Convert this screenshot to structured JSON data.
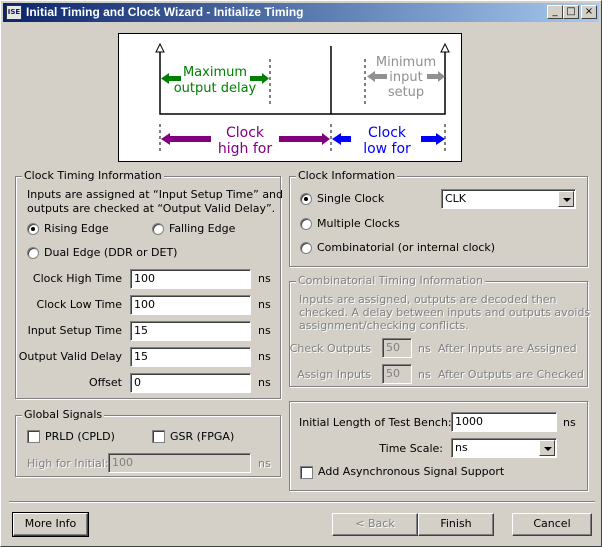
{
  "window": {
    "title": "Initial Timing and Clock Wizard - Initialize Timing",
    "app_icon_text": "ISE",
    "minimize_glyph": "_",
    "maximize_glyph": "□",
    "close_glyph": "×"
  },
  "diagram": {
    "max_output_delay": [
      "Maximum",
      "output delay"
    ],
    "min_input_setup": [
      "Minimum",
      "input",
      "setup"
    ],
    "clock_high_for": [
      "Clock",
      "high for"
    ],
    "clock_low_for": [
      "Clock",
      "low for"
    ],
    "colors": {
      "green": "#008000",
      "gray": "#909090",
      "purple": "#800080",
      "blue": "#0000ff"
    }
  },
  "clock_timing": {
    "label": "Clock Timing Information",
    "description_line1": "Inputs are assigned at “Input Setup Time” and",
    "description_line2": "outputs are checked at “Output Valid Delay”.",
    "rising_edge": "Rising Edge",
    "falling_edge": "Falling Edge",
    "dual_edge": "Dual Edge (DDR or DET)",
    "fields": [
      {
        "label": "Clock High Time",
        "value": "100",
        "unit": "ns"
      },
      {
        "label": "Clock Low Time",
        "value": "100",
        "unit": "ns"
      },
      {
        "label": "Input Setup Time",
        "value": "15",
        "unit": "ns"
      },
      {
        "label": "Output Valid Delay",
        "value": "15",
        "unit": "ns"
      },
      {
        "label": "Offset",
        "value": "0",
        "unit": "ns"
      }
    ]
  },
  "global_signals": {
    "label": "Global Signals",
    "prld": "PRLD (CPLD)",
    "gsr": "GSR (FPGA)",
    "high_for_initial_label": "High for Initial:",
    "high_for_initial_value": "100",
    "unit": "ns"
  },
  "clock_info": {
    "label": "Clock Information",
    "single_clock": "Single Clock",
    "multiple_clocks": "Multiple Clocks",
    "combinatorial": "Combinatorial (or internal clock)",
    "clock_select_value": "CLK"
  },
  "comb_timing": {
    "label": "Combinatorial Timing Information",
    "desc1": "Inputs are assigned, outputs are decoded then",
    "desc2": "checked.  A delay between inputs and outputs avoids",
    "desc3": "assignment/checking conflicts.",
    "check_outputs_label": "Check Outputs",
    "check_outputs_value": "50",
    "check_outputs_after": "After Inputs are Assigned",
    "assign_inputs_label": "Assign Inputs",
    "assign_inputs_value": "50",
    "assign_inputs_after": "After Outputs are Checked",
    "unit": "ns"
  },
  "test_bench": {
    "length_label": "Initial Length of Test Bench:",
    "length_value": "1000",
    "unit": "ns",
    "time_scale_label": "Time Scale:",
    "time_scale_value": "ns",
    "async_label": "Add Asynchronous Signal Support"
  },
  "buttons": {
    "more_info": "More Info",
    "back": "< Back",
    "finish": "Finish",
    "cancel": "Cancel"
  }
}
